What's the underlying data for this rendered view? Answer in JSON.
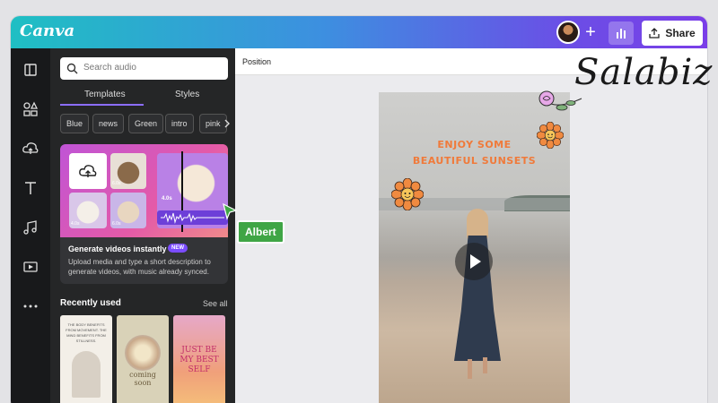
{
  "app": {
    "logo": "Canva"
  },
  "topbar": {
    "share_label": "Share",
    "plus_label": "+"
  },
  "sidebar": {
    "items": [
      "design",
      "elements",
      "uploads",
      "text",
      "audio",
      "videos",
      "more"
    ]
  },
  "panel": {
    "search_placeholder": "Search audio",
    "tabs": [
      "Templates",
      "Styles"
    ],
    "chips": [
      "Blue",
      "news",
      "Green",
      "intro",
      "pink"
    ],
    "promo": {
      "title": "Generate videos instantly",
      "badge": "NEW",
      "description": "Upload media and type a short description to generate videos, with music already synced.",
      "tile_times": [
        "6.0s",
        "4.0s",
        "4.0s",
        "6.0s"
      ]
    },
    "recent": {
      "heading": "Recently used",
      "see_all": "See all",
      "thumbs": [
        {
          "text": "THE BODY BENEFITS FROM MOVEMENT. THE MIND BENEFITS FROM STILLNESS."
        },
        {
          "text": "coming soon"
        },
        {
          "text": "JUST BE MY BEST SELF"
        }
      ]
    }
  },
  "canvas": {
    "context_label": "Position",
    "headline_1": "ENJOY SOME",
    "headline_2": "BEAUTIFUL SUNSETS"
  },
  "collaborator": {
    "name": "Albert"
  },
  "watermark": {
    "text": "Salabiz"
  },
  "colors": {
    "accent": "#7b4cff",
    "cursor": "#3fa545",
    "headline": "#f07a3a"
  }
}
